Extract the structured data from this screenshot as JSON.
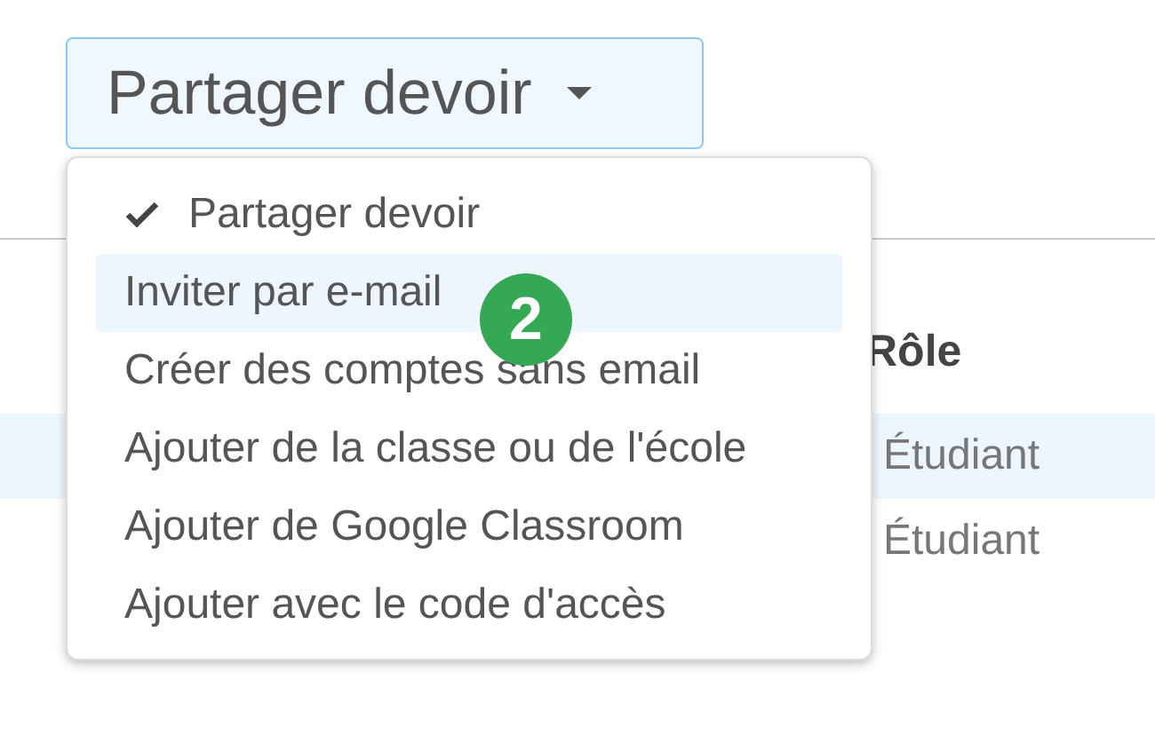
{
  "share_button": {
    "label": "Partager devoir"
  },
  "menu": {
    "items": [
      {
        "label": "Partager devoir",
        "selected": true,
        "highlighted": false
      },
      {
        "label": "Inviter par e-mail",
        "selected": false,
        "highlighted": true
      },
      {
        "label": "Créer des comptes sans email",
        "selected": false,
        "highlighted": false
      },
      {
        "label": "Ajouter de la classe ou de l'école",
        "selected": false,
        "highlighted": false
      },
      {
        "label": "Ajouter de Google Classroom",
        "selected": false,
        "highlighted": false
      },
      {
        "label": "Ajouter avec le code d'accès",
        "selected": false,
        "highlighted": false
      }
    ]
  },
  "step_badge": {
    "text": "2"
  },
  "table": {
    "columns": [
      "Rôle"
    ],
    "rows": [
      {
        "cells": [
          "Étudiant"
        ],
        "highlighted": true
      },
      {
        "cells": [
          "Étudiant"
        ],
        "highlighted": false
      }
    ]
  }
}
